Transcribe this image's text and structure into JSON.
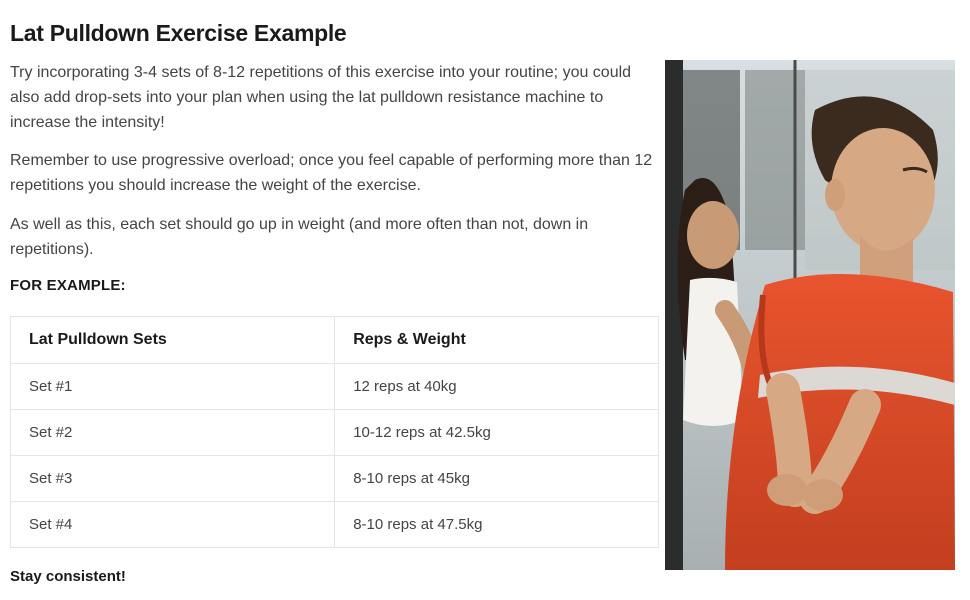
{
  "title": "Lat Pulldown Exercise Example",
  "paragraphs": [
    "Try incorporating 3-4 sets of 8-12 repetitions of this exercise into your routine; you could also add drop-sets into your plan when using the lat pulldown resistance machine to increase the intensity!",
    "Remember to use progressive overload; once you feel capable of performing more than 12 repetitions you should increase the weight of the exercise.",
    "As well as this, each set should go up in weight (and more often than not, down in repetitions)."
  ],
  "example_label": "FOR EXAMPLE:",
  "table": {
    "headers": [
      "Lat Pulldown Sets",
      "Reps & Weight"
    ],
    "rows": [
      {
        "set": "Set #1",
        "detail": "12 reps at 40kg"
      },
      {
        "set": "Set #2",
        "detail": "10-12 reps at 42.5kg"
      },
      {
        "set": "Set #3",
        "detail": "8-10 reps at 45kg"
      },
      {
        "set": "Set #4",
        "detail": "8-10 reps at 47.5kg"
      }
    ]
  },
  "closing": "Stay consistent!",
  "image_alt": "Man in orange shirt performing lat pulldown with female trainer"
}
